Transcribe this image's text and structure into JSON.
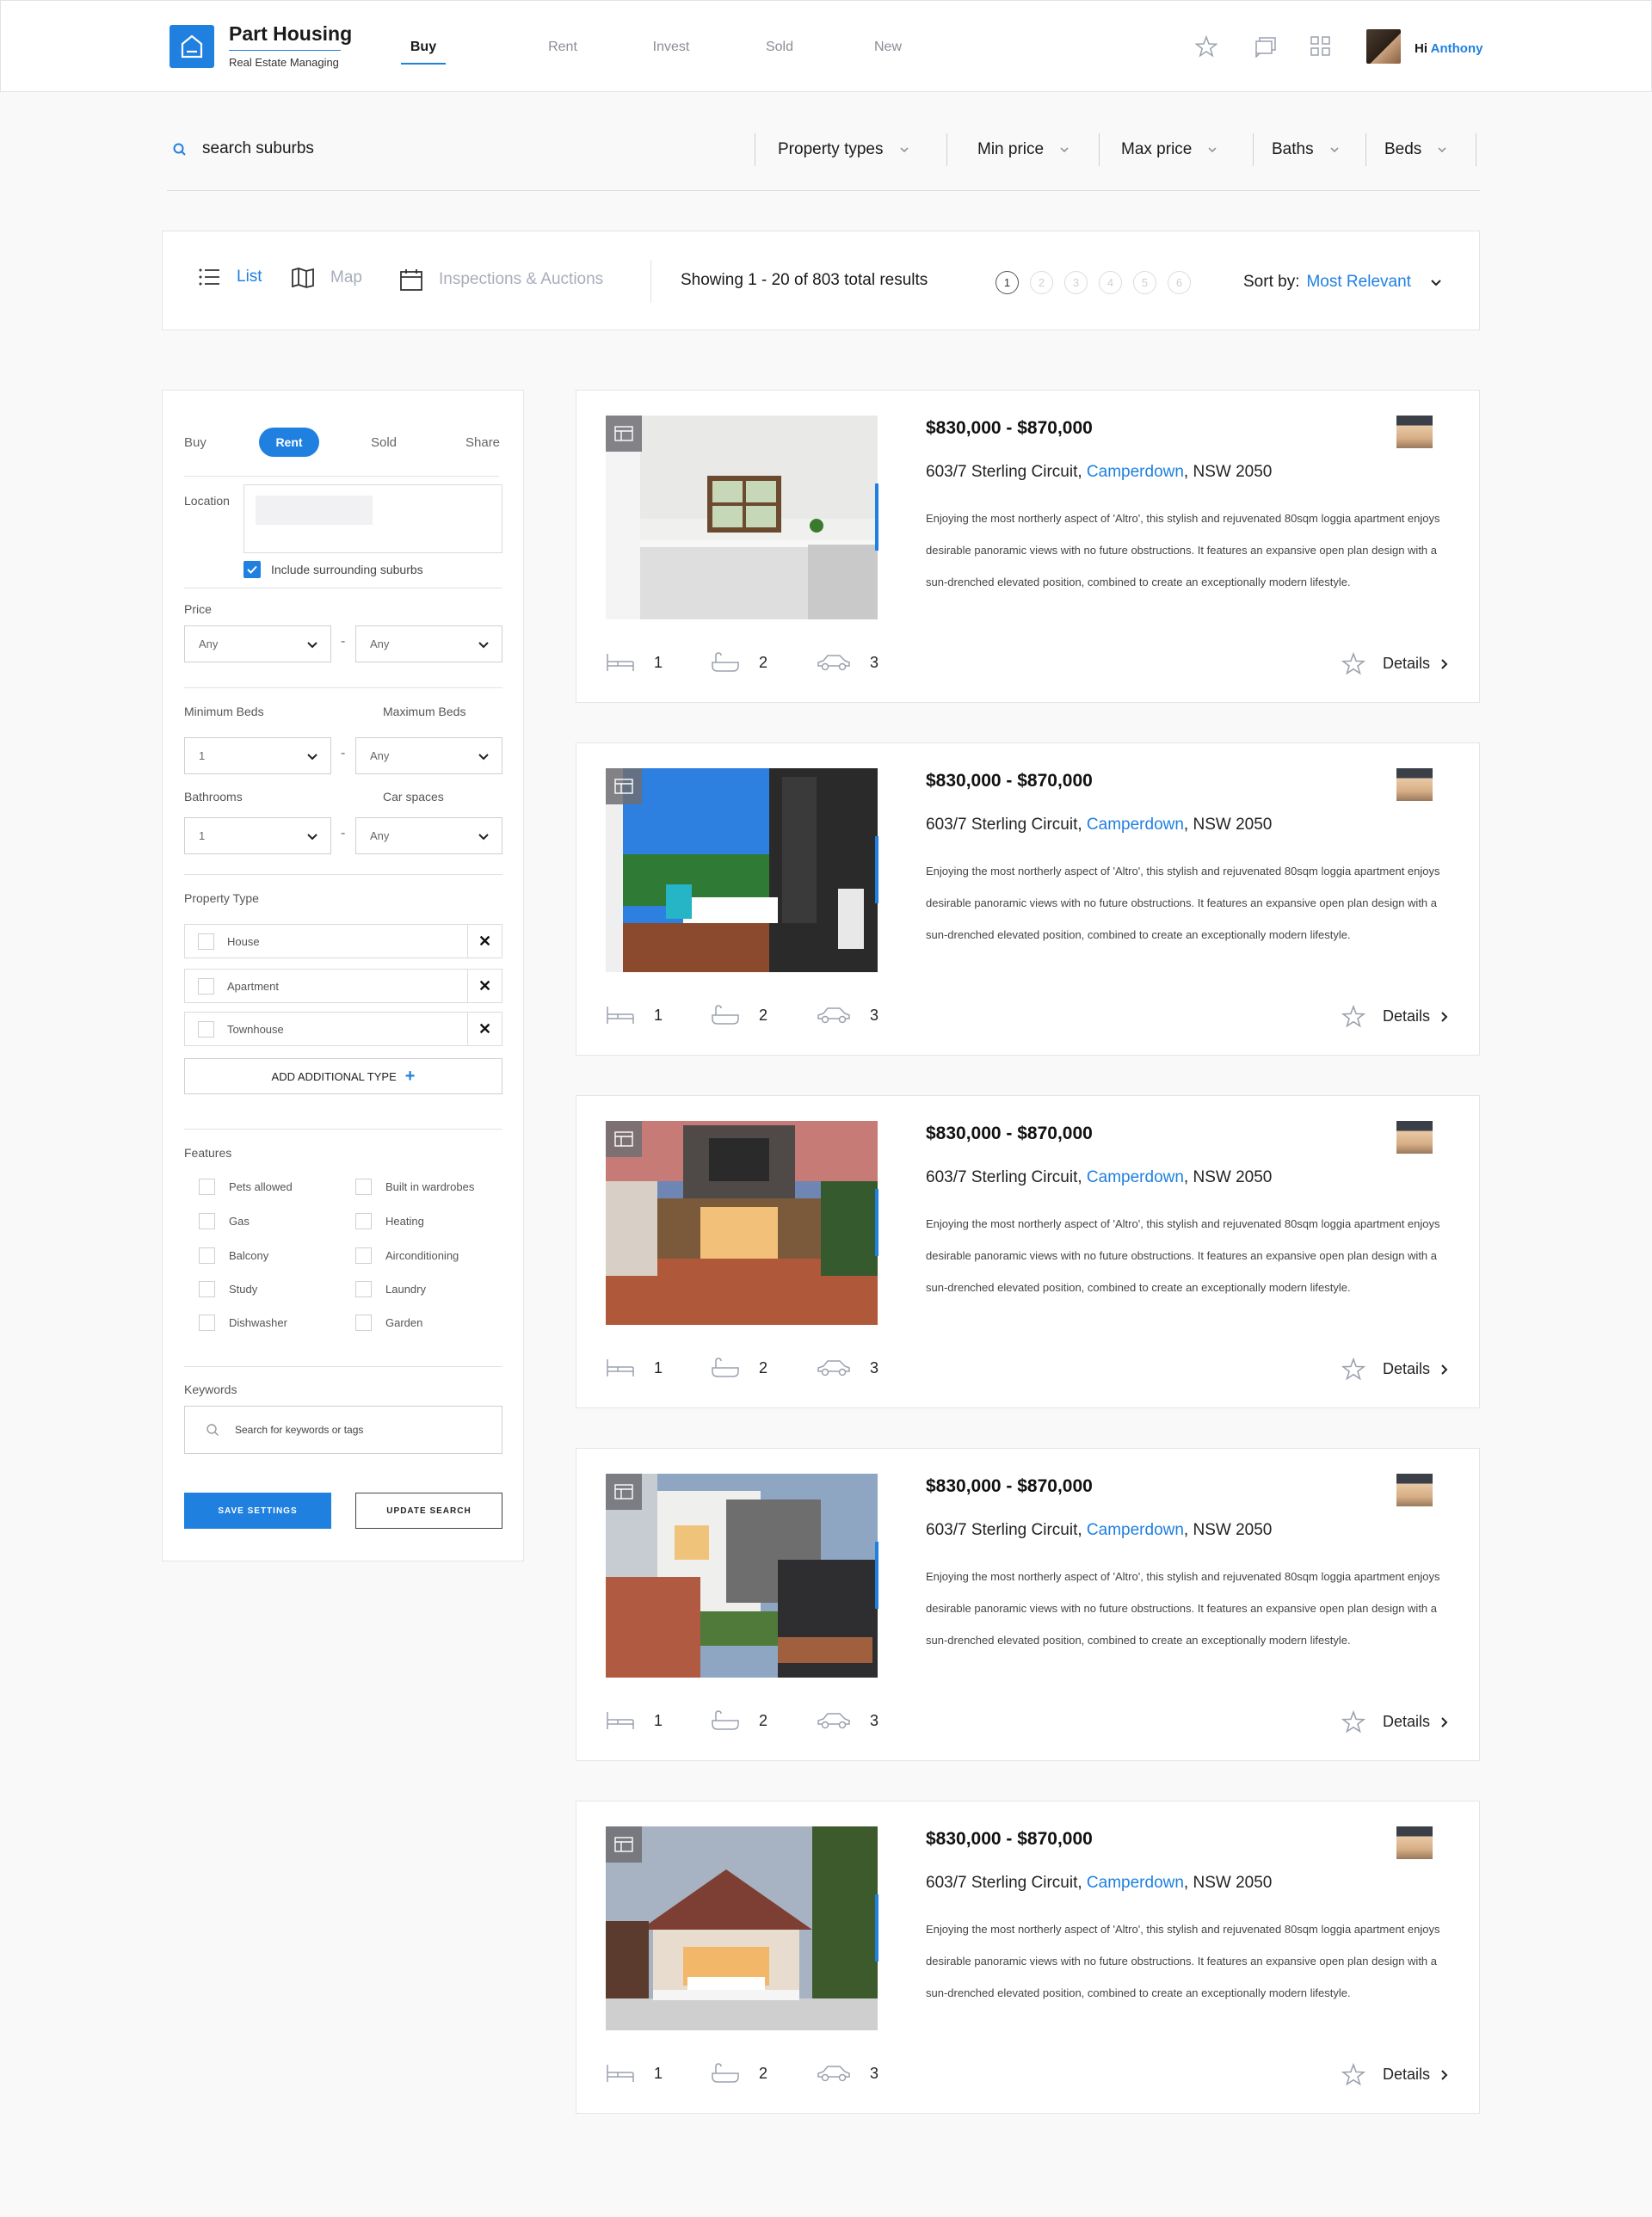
{
  "brand": {
    "title": "Part Housing",
    "subtitle": "Real Estate Managing"
  },
  "nav": [
    {
      "label": "Buy",
      "active": true
    },
    {
      "label": "Rent"
    },
    {
      "label": "Invest"
    },
    {
      "label": "Sold"
    },
    {
      "label": "New"
    }
  ],
  "user": {
    "greeting": "Hi",
    "name": "Anthony"
  },
  "search": {
    "placeholder": "search suburbs",
    "filters": [
      "Property types",
      "Min price",
      "Max price",
      "Baths",
      "Beds"
    ]
  },
  "toolbar": {
    "views": [
      "List",
      "Map",
      "Inspections & Auctions"
    ],
    "results": "Showing 1 - 20 of 803 total results",
    "pages": [
      "1",
      "2",
      "3",
      "4",
      "5",
      "6"
    ],
    "sort_label": "Sort by:",
    "sort_value": "Most Relevant"
  },
  "sidebar": {
    "tabs": [
      "Buy",
      "Rent",
      "Sold",
      "Share"
    ],
    "location_label": "Location",
    "include_label": "Include surrounding suburbs",
    "price_label": "Price",
    "price_min": "Any",
    "price_max": "Any",
    "min_beds_label": "Minimum Beds",
    "max_beds_label": "Maximum Beds",
    "min_beds": "1",
    "max_beds": "Any",
    "bathrooms_label": "Bathrooms",
    "car_label": "Car spaces",
    "bathrooms": "1",
    "car": "Any",
    "property_type_label": "Property Type",
    "property_types": [
      "House",
      "Apartment",
      "Townhouse"
    ],
    "add_type": "ADD ADDITIONAL TYPE",
    "features_label": "Features",
    "features_left": [
      "Pets allowed",
      "Gas",
      "Balcony",
      "Study",
      "Dishwasher"
    ],
    "features_right": [
      "Built in wardrobes",
      "Heating",
      "Airconditioning",
      "Laundry",
      "Garden"
    ],
    "keywords_label": "Keywords",
    "keywords_placeholder": "Search for keywords or tags",
    "save_label": "SAVE SETTINGS",
    "update_label": "UPDATE SEARCH"
  },
  "listings": [
    {
      "price": "$830,000 - $870,000",
      "addr_pre": "603/7 Sterling Circuit, ",
      "suburb": "Camperdown",
      "addr_post": ", NSW 2050",
      "desc": "Enjoying the most northerly aspect of 'Altro', this stylish and rejuvenated 80sqm loggia apartment enjoys desirable panoramic views with no future obstructions. It features an expansive open plan design with a sun-drenched elevated position, combined to create an exceptionally modern lifestyle.",
      "beds": "1",
      "baths": "2",
      "cars": "3",
      "details": "Details"
    },
    {
      "price": "$830,000 - $870,000",
      "addr_pre": "603/7 Sterling Circuit, ",
      "suburb": "Camperdown",
      "addr_post": ", NSW 2050",
      "desc": "Enjoying the most northerly aspect of 'Altro', this stylish and rejuvenated 80sqm loggia apartment enjoys desirable panoramic views with no future obstructions. It features an expansive open plan design with a sun-drenched elevated position, combined to create an exceptionally modern lifestyle.",
      "beds": "1",
      "baths": "2",
      "cars": "3",
      "details": "Details"
    },
    {
      "price": "$830,000 - $870,000",
      "addr_pre": "603/7 Sterling Circuit, ",
      "suburb": "Camperdown",
      "addr_post": ", NSW 2050",
      "desc": "Enjoying the most northerly aspect of 'Altro', this stylish and rejuvenated 80sqm loggia apartment enjoys desirable panoramic views with no future obstructions. It features an expansive open plan design with a sun-drenched elevated position, combined to create an exceptionally modern lifestyle.",
      "beds": "1",
      "baths": "2",
      "cars": "3",
      "details": "Details"
    },
    {
      "price": "$830,000 - $870,000",
      "addr_pre": "603/7 Sterling Circuit, ",
      "suburb": "Camperdown",
      "addr_post": ", NSW 2050",
      "desc": "Enjoying the most northerly aspect of 'Altro', this stylish and rejuvenated 80sqm loggia apartment enjoys desirable panoramic views with no future obstructions. It features an expansive open plan design with a sun-drenched elevated position, combined to create an exceptionally modern lifestyle.",
      "beds": "1",
      "baths": "2",
      "cars": "3",
      "details": "Details"
    },
    {
      "price": "$830,000 - $870,000",
      "addr_pre": "603/7 Sterling Circuit, ",
      "suburb": "Camperdown",
      "addr_post": ", NSW 2050",
      "desc": "Enjoying the most northerly aspect of 'Altro', this stylish and rejuvenated 80sqm loggia apartment enjoys desirable panoramic views with no future obstructions. It features an expansive open plan design with a sun-drenched elevated position, combined to create an exceptionally modern lifestyle.",
      "beds": "1",
      "baths": "2",
      "cars": "3",
      "details": "Details"
    }
  ],
  "colors": {
    "accent": "#1f80e0",
    "text": "#1b1b1b",
    "muted": "#a8adb9",
    "background": "#f9f9fa"
  }
}
